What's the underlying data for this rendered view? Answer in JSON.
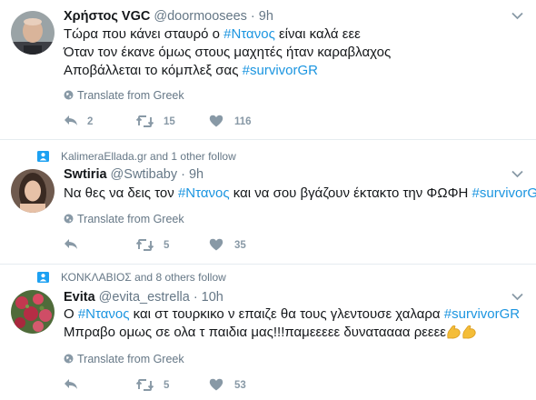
{
  "tweets": [
    {
      "name": "Χρήστος VGC",
      "handle": "@doormoosees",
      "separator": "·",
      "time": "9h",
      "lines": [
        [
          {
            "t": "Τώρα που κάνει σταυρό ο "
          },
          {
            "t": "#Ντανος",
            "tag": true
          },
          {
            "t": " είναι καλά εεε"
          }
        ],
        [
          {
            "t": "Όταν τον έκανε όμως στους μαχητές ήταν καραβλαχος"
          }
        ],
        [
          {
            "t": "Αποβάλλεται το κόμπλεξ σας "
          },
          {
            "t": "#survivorGR",
            "tag": true
          }
        ]
      ],
      "translate": "Translate from Greek",
      "replies": "2",
      "retweets": "15",
      "likes": "116"
    },
    {
      "context": "KalimeraEllada.gr and 1 other follow",
      "name": "Swtiria",
      "handle": "@Swtibaby",
      "separator": "·",
      "time": "9h",
      "lines": [
        [
          {
            "t": "Να θες να δεις τον "
          },
          {
            "t": "#Ντανος",
            "tag": true
          },
          {
            "t": " και να σου βγάζουν έκτακτο την ΦΩΦΗ "
          },
          {
            "t": "#survivorGR",
            "tag": true
          }
        ]
      ],
      "translate": "Translate from Greek",
      "replies": "",
      "retweets": "5",
      "likes": "35"
    },
    {
      "context": "ΚΟΝΚΛΑΒΙΟΣ and 8 others follow",
      "name": "Evita",
      "handle": "@evita_estrella",
      "separator": "·",
      "time": "10h",
      "lines": [
        [
          {
            "t": "Ο "
          },
          {
            "t": "#Ντανος",
            "tag": true
          },
          {
            "t": " και στ τουρκικο ν επαιζε θα τους γλεντουσε χαλαρα "
          },
          {
            "t": "#survivorGR",
            "tag": true
          }
        ],
        [
          {
            "t": "Μπραβο ομως σε ολα τ παιδια μας!!!παμεεεεε δυναταααα ρεεεε"
          },
          {
            "emoji": "flexed-biceps"
          },
          {
            "emoji": "flexed-biceps"
          }
        ]
      ],
      "translate": "Translate from Greek",
      "replies": "",
      "retweets": "5",
      "likes": "53"
    }
  ],
  "icons": {
    "reply": "reply-icon",
    "retweet": "retweet-icon",
    "like": "heart-icon",
    "globe": "globe-icon",
    "chevron": "chevron-down-icon",
    "follow": "person-icon"
  },
  "colors": {
    "hashtag": "#1b95e0",
    "secondary": "#657786",
    "action": "#8899a6",
    "context_icon": "#1da1f2"
  }
}
